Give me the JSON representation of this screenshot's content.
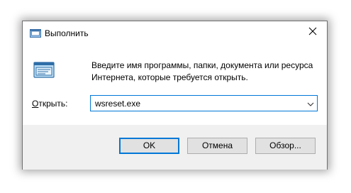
{
  "window": {
    "title": "Выполнить",
    "close_icon": "close-icon"
  },
  "description": {
    "line1": "Введите имя программы, папки, документа или ресурса",
    "line2": "Интернета, которые требуется открыть."
  },
  "open_field": {
    "label_mnemonic": "О",
    "label_rest": "ткрыть:",
    "value": "wsreset.exe"
  },
  "buttons": {
    "ok": "OK",
    "cancel": "Отмена",
    "browse": "Обзор..."
  },
  "colors": {
    "accent": "#0078d7",
    "footer_bg": "#f0f0f0",
    "button_bg": "#e1e1e1"
  }
}
